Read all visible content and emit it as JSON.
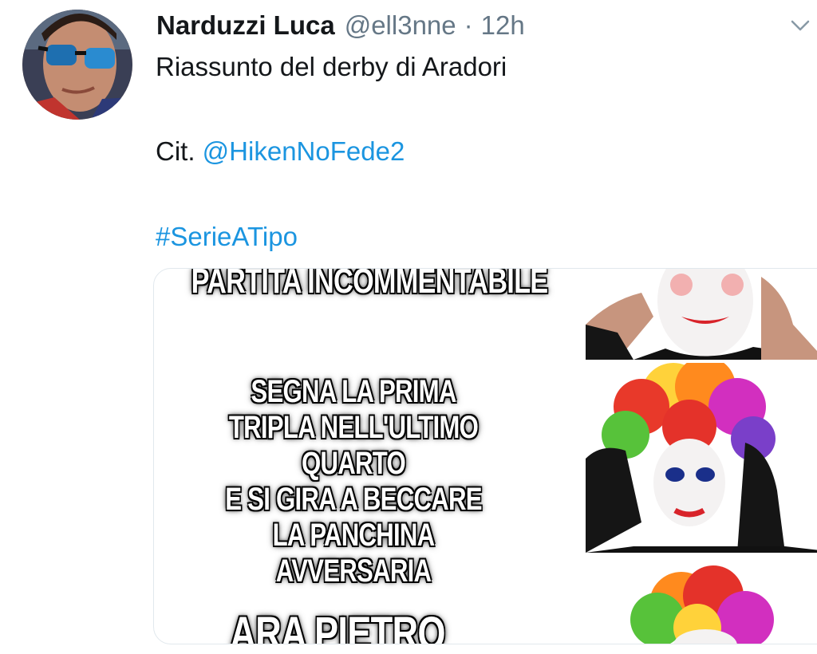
{
  "tweet": {
    "author_name": "Narduzzi Luca",
    "handle": "@ell3nne",
    "separator": "·",
    "time": "12h",
    "text_line1": "Riassunto del derby di Aradori",
    "cit_prefix": "Cit.",
    "mention": "@HikenNoFede2",
    "hashtag": "#SerieATipo"
  },
  "meme": {
    "top_text": "PARTITA INCOMMENTABILE",
    "middle_lines": [
      "SEGNA LA PRIMA",
      "TRIPLA NELL'ULTIMO QUARTO",
      "E SI GIRA A BECCARE",
      "LA PANCHINA AVVERSARIA"
    ],
    "bottom_text": "ARA PIETRO"
  },
  "icons": {
    "caret": "chevron-down-icon"
  },
  "colors": {
    "link": "#1b95e0",
    "secondary_text": "#657786",
    "primary_text": "#14171a"
  }
}
